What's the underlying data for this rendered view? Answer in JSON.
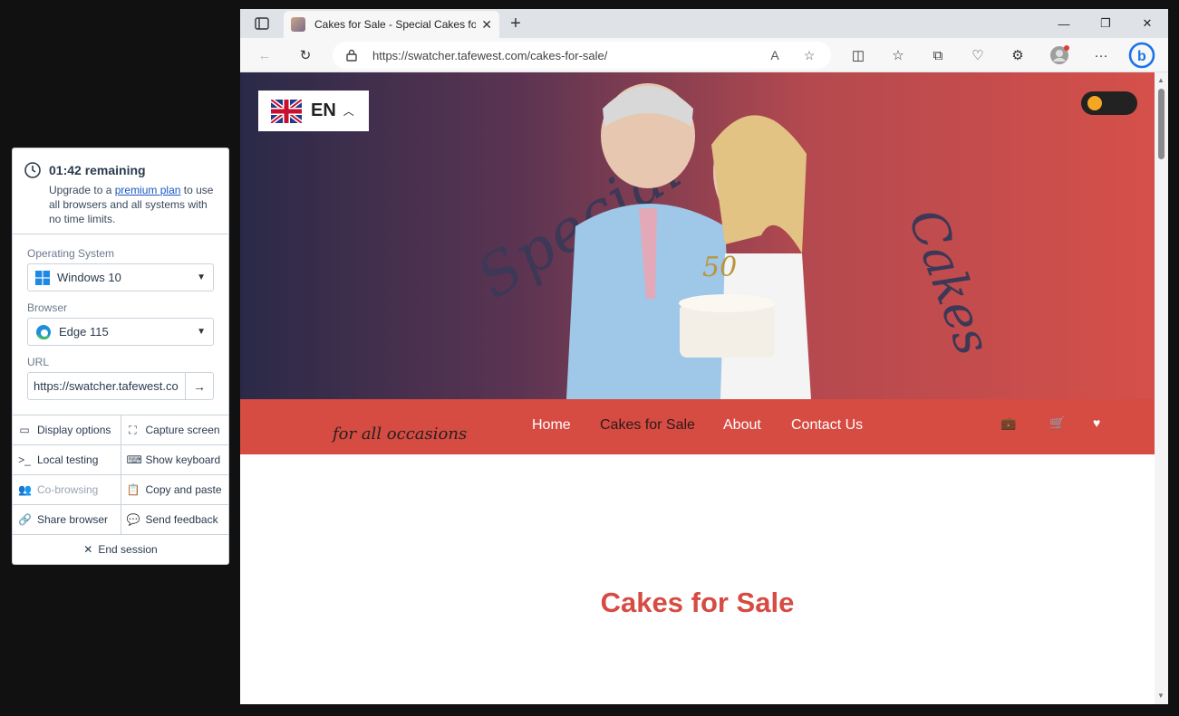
{
  "session_panel": {
    "timer": "01:42 remaining",
    "upgrade_prefix": "Upgrade to a ",
    "upgrade_link": "premium plan",
    "upgrade_suffix": " to use all browsers and all systems with no time limits.",
    "os_label": "Operating System",
    "os_value": "Windows 10",
    "browser_label": "Browser",
    "browser_value": "Edge 115",
    "url_label": "URL",
    "url_value": "https://swatcher.tafewest.co",
    "actions": [
      {
        "label": "Display options",
        "icon": "monitor-icon"
      },
      {
        "label": "Capture screen",
        "icon": "capture-icon"
      },
      {
        "label": "Local testing",
        "icon": "terminal-icon"
      },
      {
        "label": "Show keyboard",
        "icon": "keyboard-icon"
      },
      {
        "label": "Co-browsing",
        "icon": "users-icon",
        "disabled": true
      },
      {
        "label": "Copy and paste",
        "icon": "clipboard-icon"
      },
      {
        "label": "Share browser",
        "icon": "link-icon"
      },
      {
        "label": "Send feedback",
        "icon": "chat-icon"
      }
    ],
    "end_session": "End session"
  },
  "browser": {
    "tab_title": "Cakes for Sale - Special Cakes for",
    "url": "https://swatcher.tafewest.com/cakes-for-sale/"
  },
  "site": {
    "language": "EN",
    "hero_word_left": "Special",
    "hero_word_right": "Cakes",
    "tagline": "for all occasions",
    "nav": [
      "Home",
      "Cakes for Sale",
      "About",
      "Contact Us"
    ],
    "active_nav": "Cakes for Sale",
    "section_title": "Cakes for Sale"
  },
  "colors": {
    "accent": "#d64b42",
    "link": "#1a56c4",
    "toggle_knob": "#f5a623"
  }
}
